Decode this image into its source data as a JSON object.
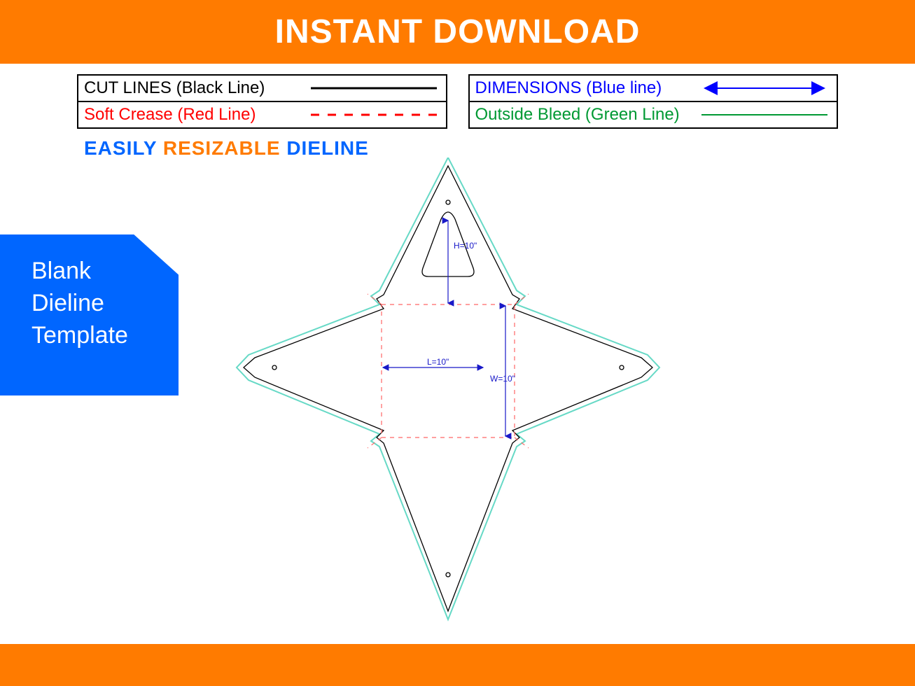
{
  "banner": {
    "title": "INSTANT DOWNLOAD"
  },
  "legend": {
    "cut": {
      "label": "CUT LINES (Black Line)",
      "color": "#000000",
      "style": "solid"
    },
    "crease": {
      "label": "Soft Crease (Red Line)",
      "color": "#ff0000",
      "style": "dashed"
    },
    "dims": {
      "label": "DIMENSIONS (Blue line)",
      "color": "#0000ff",
      "style": "arrow"
    },
    "bleed": {
      "label": "Outside Bleed (Green Line)",
      "color": "#009933",
      "style": "solid"
    }
  },
  "tagline": {
    "word1": "EASILY",
    "word2": "RESIZABLE",
    "word3": "DIELINE"
  },
  "badge": {
    "line1": "Blank",
    "line2": "Dieline",
    "line3": "Template"
  },
  "dimensions": {
    "L": "L=10\"",
    "W": "W=10\"",
    "H": "H=10\""
  },
  "colors": {
    "accent": "#ff7b00",
    "blue": "#0066ff",
    "dim": "#1818c8",
    "bleed": "#66d9c6",
    "crease": "#ff6666"
  }
}
